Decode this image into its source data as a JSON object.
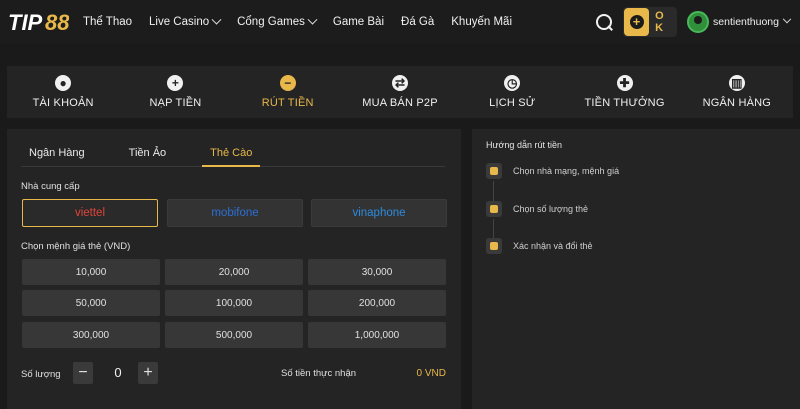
{
  "header": {
    "logo_text": "TIP88",
    "nav": [
      {
        "label": "Thể Thao",
        "dropdown": false
      },
      {
        "label": "Live Casino",
        "dropdown": true
      },
      {
        "label": "Cổng Games",
        "dropdown": true
      },
      {
        "label": "Game Bài",
        "dropdown": false
      },
      {
        "label": "Đá Gà",
        "dropdown": false
      },
      {
        "label": "Khuyến Mãi",
        "dropdown": false
      }
    ],
    "ok_label": "O K",
    "username": "sentienthuong"
  },
  "tabs": [
    {
      "label": "TÀI KHOẢN",
      "icon": "user-icon",
      "glyph": "●"
    },
    {
      "label": "NẠP TIỀN",
      "icon": "plus-icon",
      "glyph": "+"
    },
    {
      "label": "RÚT TIỀN",
      "icon": "minus-icon",
      "glyph": "−"
    },
    {
      "label": "MUA BÁN P2P",
      "icon": "exchange-icon",
      "glyph": "⇄"
    },
    {
      "label": "LỊCH SỬ",
      "icon": "clock-icon",
      "glyph": "◷"
    },
    {
      "label": "TIỀN THƯỞNG",
      "icon": "gift-icon",
      "glyph": "✚"
    },
    {
      "label": "NGÂN HÀNG",
      "icon": "bank-icon",
      "glyph": "▥"
    }
  ],
  "active_tab": "RÚT TIỀN",
  "withdraw": {
    "subtabs": [
      "Ngân Hàng",
      "Tiền Ảo",
      "Thẻ Cào"
    ],
    "active_subtab": "Thẻ Cào",
    "provider_label": "Nhà cung cấp",
    "providers": [
      {
        "name": "viettel",
        "color": "#e0443a"
      },
      {
        "name": "mobifone",
        "color": "#2b6fd6"
      },
      {
        "name": "vinaphone",
        "color": "#2e8be0"
      }
    ],
    "denomination_label": "Chọn mệnh giá thẻ (VND)",
    "denominations": [
      "10,000",
      "20,000",
      "30,000",
      "50,000",
      "100,000",
      "200,000",
      "300,000",
      "500,000",
      "1,000,000"
    ],
    "quantity_label": "Số lượng",
    "quantity": "0",
    "receive_label": "Số tiền thực nhận",
    "receive_value": "0 VND"
  },
  "guide": {
    "title": "Hướng dẫn rút tiền",
    "steps": [
      "Chọn nhà mạng, mệnh giá",
      "Chọn số lượng thẻ",
      "Xác nhận và đổi thẻ"
    ]
  },
  "colors": {
    "accent": "#e8b84a",
    "panel": "#242424",
    "background": "#1a1a1a"
  }
}
